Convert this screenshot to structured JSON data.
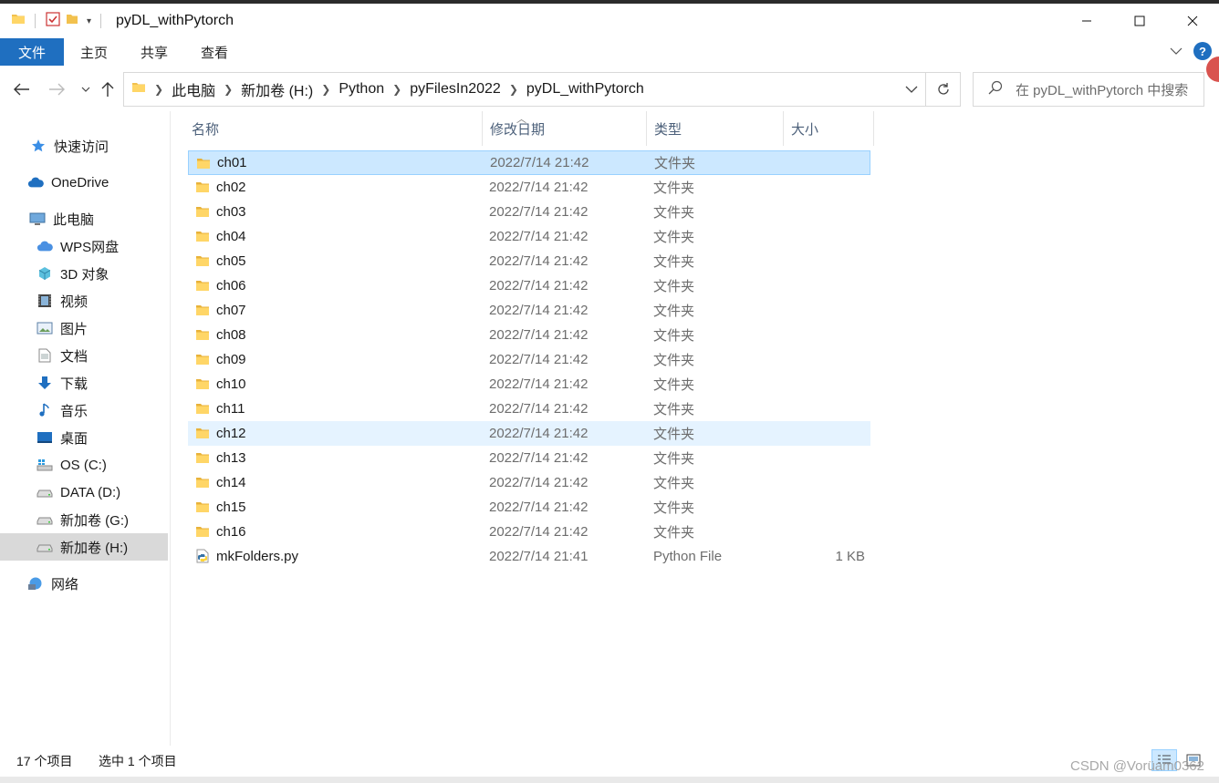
{
  "window": {
    "title": "pyDL_withPytorch",
    "controls": [
      "minimize",
      "maximize",
      "close"
    ]
  },
  "ribbon": {
    "tabs": [
      "文件",
      "主页",
      "共享",
      "查看"
    ]
  },
  "address": {
    "crumbs": [
      "此电脑",
      "新加卷 (H:)",
      "Python",
      "pyFilesIn2022",
      "pyDL_withPytorch"
    ]
  },
  "search": {
    "placeholder": "在 pyDL_withPytorch 中搜索"
  },
  "sidebar": {
    "items": [
      {
        "label": "快速访问",
        "icon": "star-icon"
      },
      {
        "label": "OneDrive",
        "icon": "cloud-icon"
      },
      {
        "label": "此电脑",
        "icon": "computer-icon"
      },
      {
        "label": "WPS网盘",
        "icon": "cloud-drive-icon"
      },
      {
        "label": "3D 对象",
        "icon": "cube-icon"
      },
      {
        "label": "视频",
        "icon": "video-icon"
      },
      {
        "label": "图片",
        "icon": "picture-icon"
      },
      {
        "label": "文档",
        "icon": "document-icon"
      },
      {
        "label": "下载",
        "icon": "download-icon"
      },
      {
        "label": "音乐",
        "icon": "music-icon"
      },
      {
        "label": "桌面",
        "icon": "desktop-icon"
      },
      {
        "label": "OS (C:)",
        "icon": "drive-icon"
      },
      {
        "label": "DATA (D:)",
        "icon": "drive-icon"
      },
      {
        "label": "新加卷 (G:)",
        "icon": "drive-icon"
      },
      {
        "label": "新加卷 (H:)",
        "icon": "drive-icon"
      },
      {
        "label": "网络",
        "icon": "network-icon"
      }
    ]
  },
  "columns": {
    "name": "名称",
    "modified": "修改日期",
    "type": "类型",
    "size": "大小"
  },
  "files": [
    {
      "name": "ch01",
      "modified": "2022/7/14 21:42",
      "type": "文件夹",
      "size": "",
      "kind": "folder"
    },
    {
      "name": "ch02",
      "modified": "2022/7/14 21:42",
      "type": "文件夹",
      "size": "",
      "kind": "folder"
    },
    {
      "name": "ch03",
      "modified": "2022/7/14 21:42",
      "type": "文件夹",
      "size": "",
      "kind": "folder"
    },
    {
      "name": "ch04",
      "modified": "2022/7/14 21:42",
      "type": "文件夹",
      "size": "",
      "kind": "folder"
    },
    {
      "name": "ch05",
      "modified": "2022/7/14 21:42",
      "type": "文件夹",
      "size": "",
      "kind": "folder"
    },
    {
      "name": "ch06",
      "modified": "2022/7/14 21:42",
      "type": "文件夹",
      "size": "",
      "kind": "folder"
    },
    {
      "name": "ch07",
      "modified": "2022/7/14 21:42",
      "type": "文件夹",
      "size": "",
      "kind": "folder"
    },
    {
      "name": "ch08",
      "modified": "2022/7/14 21:42",
      "type": "文件夹",
      "size": "",
      "kind": "folder"
    },
    {
      "name": "ch09",
      "modified": "2022/7/14 21:42",
      "type": "文件夹",
      "size": "",
      "kind": "folder"
    },
    {
      "name": "ch10",
      "modified": "2022/7/14 21:42",
      "type": "文件夹",
      "size": "",
      "kind": "folder"
    },
    {
      "name": "ch11",
      "modified": "2022/7/14 21:42",
      "type": "文件夹",
      "size": "",
      "kind": "folder"
    },
    {
      "name": "ch12",
      "modified": "2022/7/14 21:42",
      "type": "文件夹",
      "size": "",
      "kind": "folder"
    },
    {
      "name": "ch13",
      "modified": "2022/7/14 21:42",
      "type": "文件夹",
      "size": "",
      "kind": "folder"
    },
    {
      "name": "ch14",
      "modified": "2022/7/14 21:42",
      "type": "文件夹",
      "size": "",
      "kind": "folder"
    },
    {
      "name": "ch15",
      "modified": "2022/7/14 21:42",
      "type": "文件夹",
      "size": "",
      "kind": "folder"
    },
    {
      "name": "ch16",
      "modified": "2022/7/14 21:42",
      "type": "文件夹",
      "size": "",
      "kind": "folder"
    },
    {
      "name": "mkFolders.py",
      "modified": "2022/7/14 21:41",
      "type": "Python File",
      "size": "1 KB",
      "kind": "python"
    }
  ],
  "status": {
    "count": "17 个项目",
    "selected": "选中 1 个项目"
  },
  "watermark": "CSDN @Vorüam0362",
  "colors": {
    "accent": "#1f6fc0",
    "selection": "#cce8ff",
    "hover": "#e5f3ff",
    "folder": "#f2c14e"
  }
}
